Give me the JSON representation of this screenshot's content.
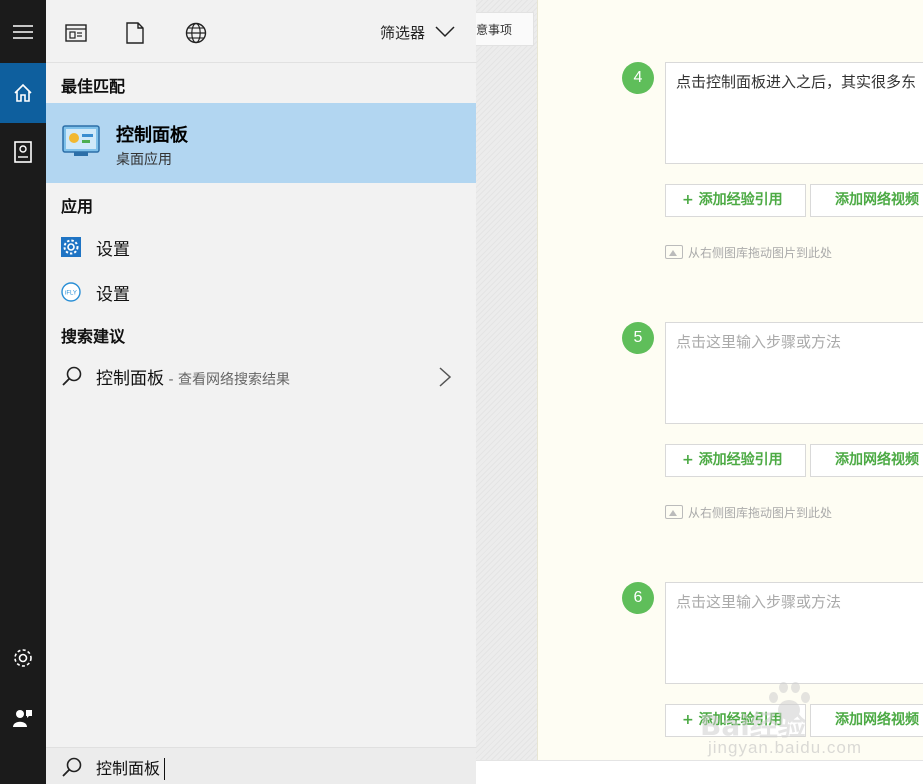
{
  "background_page": {
    "tab_label": "意事项",
    "steps": [
      {
        "number": "4",
        "text": "点击控制面板进入之后，其实很多东",
        "is_placeholder": false
      },
      {
        "number": "5",
        "text": "点击这里输入步骤或方法",
        "is_placeholder": true
      },
      {
        "number": "6",
        "text": "点击这里输入步骤或方法",
        "is_placeholder": true
      }
    ],
    "add_experience_label": "+ 添加经验引用",
    "add_video_label": "添加网络视频",
    "drag_hint": "从右侧图库拖动图片到此处",
    "watermark": {
      "logo": "Bai经验",
      "url": "jingyan.baidu.com"
    }
  },
  "rail": {
    "items": [
      {
        "name": "menu-icon"
      },
      {
        "name": "home-icon"
      },
      {
        "name": "notebook-icon"
      },
      {
        "name": "settings-icon"
      },
      {
        "name": "feedback-icon"
      }
    ]
  },
  "panel": {
    "filter_label": "筛选器",
    "best_match_title": "最佳匹配",
    "best_match": {
      "name": "控制面板",
      "subtitle": "桌面应用"
    },
    "apps_title": "应用",
    "apps": [
      {
        "label": "设置",
        "icon": "settings-gear-icon"
      },
      {
        "label": "设置",
        "icon": "ifly-icon"
      }
    ],
    "suggestions_title": "搜索建议",
    "suggestion": {
      "query": "控制面板",
      "hint": " - 查看网络搜索结果"
    },
    "search_value": "控制面板",
    "accent_color": "#0e5f9e",
    "highlight_color": "#b2d6f1"
  }
}
